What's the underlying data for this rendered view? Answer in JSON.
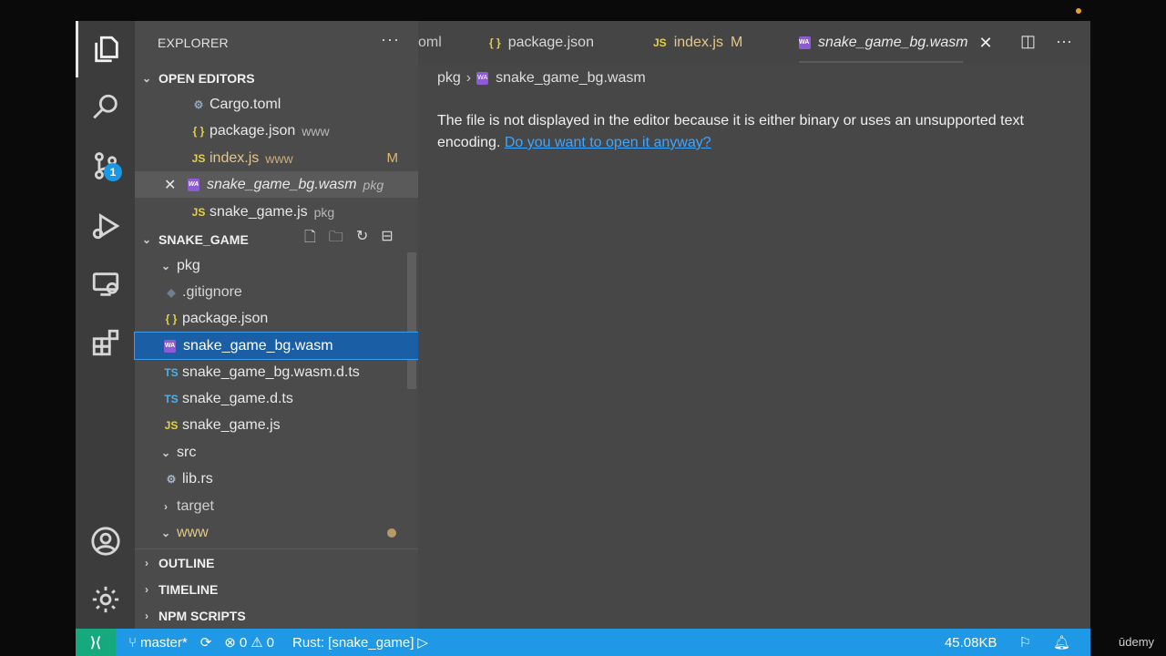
{
  "activity": {
    "scm_badge": "1"
  },
  "sidebar": {
    "title": "EXPLORER",
    "more": "···",
    "open_editors": {
      "title": "OPEN EDITORS",
      "items": [
        {
          "icon": "gear",
          "label": "Cargo.toml",
          "desc": "",
          "mod": ""
        },
        {
          "icon": "{ }",
          "label": "package.json",
          "desc": "www",
          "mod": ""
        },
        {
          "icon": "JS",
          "label": "index.js",
          "desc": "www",
          "mod": "M"
        },
        {
          "icon": "WA",
          "label": "snake_game_bg.wasm",
          "desc": "pkg",
          "mod": ""
        },
        {
          "icon": "JS",
          "label": "snake_game.js",
          "desc": "pkg",
          "mod": ""
        }
      ]
    },
    "project": {
      "title": "SNAKE_GAME",
      "tree": [
        {
          "label": "pkg"
        },
        {
          "label": ".gitignore"
        },
        {
          "label": "package.json"
        },
        {
          "label": "snake_game_bg.wasm"
        },
        {
          "label": "snake_game_bg.wasm.d.ts"
        },
        {
          "label": "snake_game.d.ts"
        },
        {
          "label": "snake_game.js"
        },
        {
          "label": "src"
        },
        {
          "label": "lib.rs"
        },
        {
          "label": "target"
        },
        {
          "label": "www"
        }
      ]
    },
    "outline": "OUTLINE",
    "timeline": "TIMELINE",
    "npm": "NPM SCRIPTS"
  },
  "tabs": [
    {
      "label": "oml"
    },
    {
      "label": "package.json"
    },
    {
      "label": "index.js",
      "mod": "M"
    },
    {
      "label": "snake_game_bg.wasm"
    }
  ],
  "editor": {
    "crumb_folder": "pkg",
    "crumb_file": "snake_game_bg.wasm",
    "message": "The file is not displayed in the editor because it is either binary or uses an unsupported text encoding.",
    "link": "Do you want to open it anyway?"
  },
  "status": {
    "branch": "master*",
    "errors": "0",
    "warnings": "0",
    "rust": "Rust: [snake_game]",
    "size": "45.08KB"
  },
  "watermark": "ūdemy",
  "colors": {
    "accent": "#1f98e6",
    "remote": "#16a97e",
    "selection": "#1a5ea6",
    "link": "#3ea6ff",
    "modified": "#e2b86b"
  }
}
